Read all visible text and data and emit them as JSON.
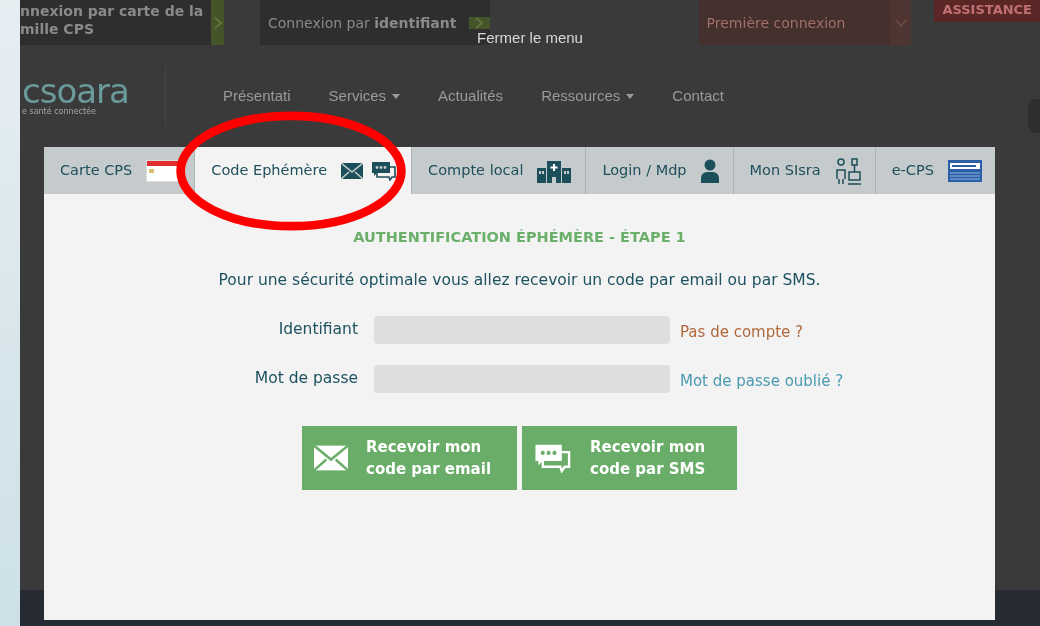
{
  "background_page": {
    "top_buttons": [
      {
        "kind": "arrow",
        "lines": [
          "nnexion par carte de la",
          "mille CPS"
        ]
      },
      {
        "kind": "arrow",
        "lines": [
          "Connexion par **identifiant**"
        ]
      },
      {
        "kind": "select",
        "lines": [
          "Première connexion"
        ]
      },
      {
        "kind": "plain",
        "lines": [
          "ASSISTANCE"
        ]
      }
    ],
    "close_menu": "Fermer le menu",
    "logo": {
      "text": "csoara",
      "tagline": "e santé connectée"
    },
    "nav": [
      {
        "label": "Présentati",
        "dropdown": false
      },
      {
        "label": "Services",
        "dropdown": true
      },
      {
        "label": "Actualités",
        "dropdown": false
      },
      {
        "label": "Ressources",
        "dropdown": true
      },
      {
        "label": "Contact",
        "dropdown": false
      }
    ]
  },
  "modal": {
    "tabs": [
      {
        "label": "Carte CPS",
        "selected": false,
        "kind": "card"
      },
      {
        "label": "Code Ephémère",
        "selected": true,
        "kind": "code"
      },
      {
        "label": "Compte local",
        "selected": false,
        "kind": "local"
      },
      {
        "label": "Login / Mdp",
        "selected": false,
        "kind": "login"
      },
      {
        "label": "Mon SIsra",
        "selected": false,
        "kind": "sisra"
      },
      {
        "label": "e-CPS",
        "selected": false,
        "kind": "ecps"
      }
    ],
    "heading": "AUTHENTIFICATION ÉPHÉMÈRE - ÉTAPE 1",
    "intro": "Pour une sécurité optimale vous allez recevoir un code par email ou par SMS.",
    "fields": [
      {
        "label": "Identifiant",
        "link": {
          "text": "Pas de compte ?",
          "color": "#b0683a"
        }
      },
      {
        "label": "Mot de passe",
        "link": {
          "text": "Mot de passe oublié ?",
          "color": "#4a9ab0"
        }
      }
    ],
    "buttons": [
      {
        "kind": "email",
        "lines": [
          "Recevoir mon",
          "code par email"
        ]
      },
      {
        "kind": "sms",
        "lines": [
          "Recevoir mon",
          "code par SMS"
        ]
      }
    ]
  }
}
